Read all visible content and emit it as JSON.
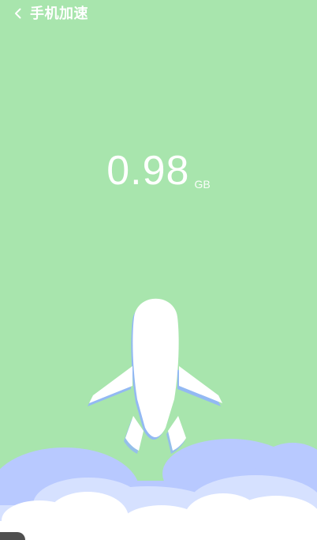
{
  "header": {
    "back_icon": "chevron-left-icon",
    "title": "手机加速"
  },
  "stats": {
    "value": "0.98",
    "unit": "GB"
  },
  "colors": {
    "background": "#a8e5ad",
    "cloud_back": "#b8c9ff",
    "cloud_mid": "#d6e1ff",
    "cloud_front": "#ffffff",
    "plane": "#ffffff",
    "plane_shadow": "#8fb1ff"
  }
}
